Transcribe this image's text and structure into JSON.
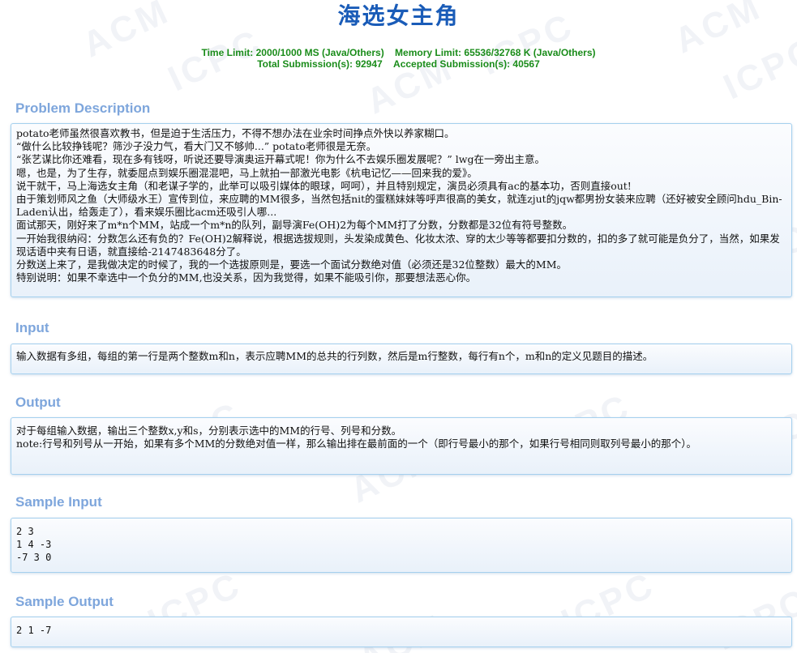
{
  "problem": {
    "title": "海选女主角",
    "time_limit": "Time Limit: 2000/1000 MS (Java/Others)",
    "memory_limit": "Memory Limit: 65536/32768 K (Java/Others)",
    "total_submissions": "Total Submission(s): 92947",
    "accepted_submissions": "Accepted Submission(s): 40567"
  },
  "sections": {
    "description": {
      "heading": "Problem Description",
      "lines": [
        "potato老师虽然很喜欢教书，但是迫于生活压力，不得不想办法在业余时间挣点外快以养家糊口。",
        "“做什么比较挣钱呢？筛沙子没力气，看大门又不够帅...” potato老师很是无奈。",
        "“张艺谋比你还难看，现在多有钱呀，听说还要导演奥运开幕式呢！你为什么不去娱乐圈发展呢？” lwg在一旁出主意。",
        "嗯，也是，为了生存，就委屈点到娱乐圈混混吧，马上就拍一部激光电影《杭电记忆——回来我的爱》。",
        "说干就干，马上海选女主角（和老谋子学的，此举可以吸引媒体的眼球，呵呵），并且特别规定，演员必须具有ac的基本功，否则直接out!",
        "由于策划师风之鱼（大师级水王）宣传到位，来应聘的MM很多，当然包括nit的蛋糕妹妹等呼声很高的美女，就连zjut的jqw都男扮女装来应聘（还好被安全顾问hdu_Bin-Laden认出，给轰走了），看来娱乐圈比acm还吸引人哪...",
        "面试那天，刚好来了m*n个MM，站成一个m*n的队列，副导演Fe(OH)2为每个MM打了分数，分数都是32位有符号整数。",
        "一开始我很纳闷：分数怎么还有负的？Fe(OH)2解释说，根据选拔规则，头发染成黄色、化妆太浓、穿的太少等等都要扣分数的，扣的多了就可能是负分了，当然，如果发现话语中夹有日语，就直接给-2147483648分了。",
        "分数送上来了，是我做决定的时候了，我的一个选拔原则是，要选一个面试分数绝对值（必须还是32位整数）最大的MM。",
        "特别说明：如果不幸选中一个负分的MM,也没关系，因为我觉得，如果不能吸引你，那要想法恶心你。"
      ]
    },
    "input": {
      "heading": "Input",
      "text": "输入数据有多组，每组的第一行是两个整数m和n，表示应聘MM的总共的行列数，然后是m行整数，每行有n个，m和n的定义见题目的描述。"
    },
    "output": {
      "heading": "Output",
      "lines": [
        "对于每组输入数据，输出三个整数x,y和s，分别表示选中的MM的行号、列号和分数。",
        "note:行号和列号从一开始，如果有多个MM的分数绝对值一样，那么输出排在最前面的一个（即行号最小的那个，如果行号相同则取列号最小的那个）。"
      ]
    },
    "sample_input": {
      "heading": "Sample Input",
      "text": "2 3\n1 4 -3\n-7 3 0"
    },
    "sample_output": {
      "heading": "Sample Output",
      "text": "2 1 -7"
    }
  },
  "watermark": {
    "texts": [
      "ICPC",
      "ACM"
    ],
    "color": "#f1f3f7"
  },
  "colors": {
    "title": "#1a5cb8",
    "limits": "#1a8c1a",
    "section_heading": "#7ea6dc",
    "panel_border": "#a5d0ee"
  }
}
